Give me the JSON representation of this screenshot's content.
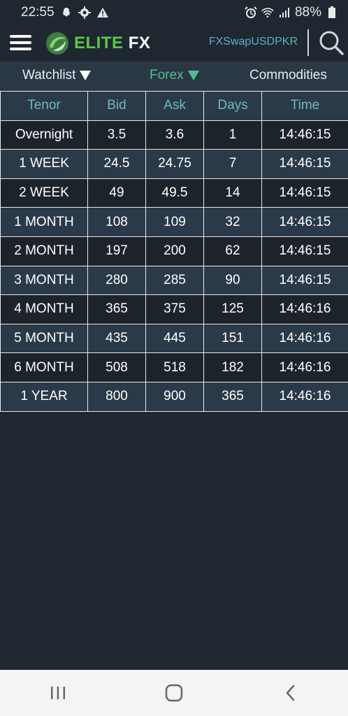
{
  "status": {
    "time": "22:55",
    "battery": "88%"
  },
  "app": {
    "brand_elite": "ELITE",
    "brand_fx": "FX",
    "symbol": "FXSwapUSDPKR"
  },
  "tabs": [
    {
      "label": "Watchlist",
      "active": false
    },
    {
      "label": "Forex",
      "active": true
    },
    {
      "label": "Commodities",
      "active": false
    }
  ],
  "table": {
    "headers": [
      "Tenor",
      "Bid",
      "Ask",
      "Days",
      "Time"
    ],
    "rows": [
      [
        "Overnight",
        "3.5",
        "3.6",
        "1",
        "14:46:15"
      ],
      [
        "1 WEEK",
        "24.5",
        "24.75",
        "7",
        "14:46:15"
      ],
      [
        "2 WEEK",
        "49",
        "49.5",
        "14",
        "14:46:15"
      ],
      [
        "1 MONTH",
        "108",
        "109",
        "32",
        "14:46:15"
      ],
      [
        "2 MONTH",
        "197",
        "200",
        "62",
        "14:46:15"
      ],
      [
        "3 MONTH",
        "280",
        "285",
        "90",
        "14:46:15"
      ],
      [
        "4 MONTH",
        "365",
        "375",
        "125",
        "14:46:16"
      ],
      [
        "5 MONTH",
        "435",
        "445",
        "151",
        "14:46:16"
      ],
      [
        "6 MONTH",
        "508",
        "518",
        "182",
        "14:46:16"
      ],
      [
        "1 YEAR",
        "800",
        "900",
        "365",
        "14:46:16"
      ]
    ]
  },
  "colors": {
    "background": "#1f2731",
    "accent_green": "#4fc08d",
    "header_text": "#6fb7c8",
    "symbol_text": "#5ab3c3"
  },
  "icons": {
    "status": [
      "snapchat-icon",
      "settings-gear-icon",
      "warning-icon",
      "alarm-icon",
      "wifi-icon",
      "signal-icon",
      "battery-icon"
    ],
    "nav": [
      "recent-apps-icon",
      "home-icon",
      "back-icon"
    ]
  }
}
